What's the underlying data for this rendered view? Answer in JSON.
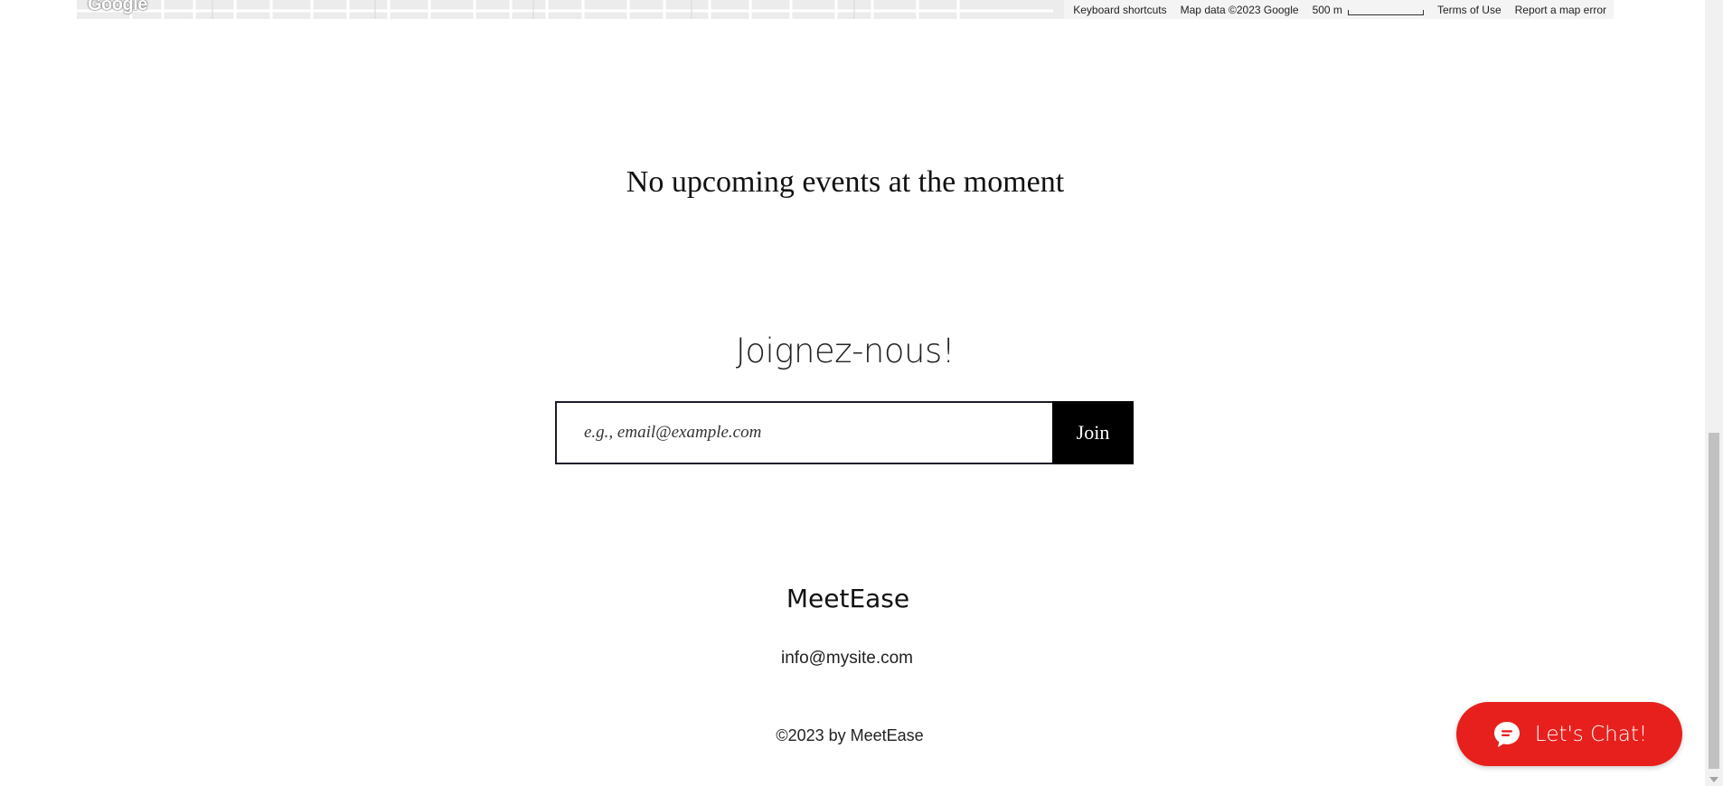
{
  "map": {
    "logo_text": "Google",
    "footer": {
      "shortcuts": "Keyboard shortcuts",
      "map_data": "Map data ©2023 Google",
      "scale_label": "500 m",
      "terms": "Terms of Use",
      "report": "Report a map error"
    }
  },
  "events": {
    "message": "No upcoming events at the moment"
  },
  "subscribe": {
    "title": "Joignez-nous!",
    "email_placeholder": "e.g., email@example.com",
    "join_label": "Join"
  },
  "footer": {
    "brand": "MeetEase",
    "email": "info@mysite.com",
    "copyright": "©2023 by MeetEase"
  },
  "chat": {
    "label": "Let's Chat!",
    "icon": "chat-bubble-icon",
    "color": "#e8201d"
  }
}
